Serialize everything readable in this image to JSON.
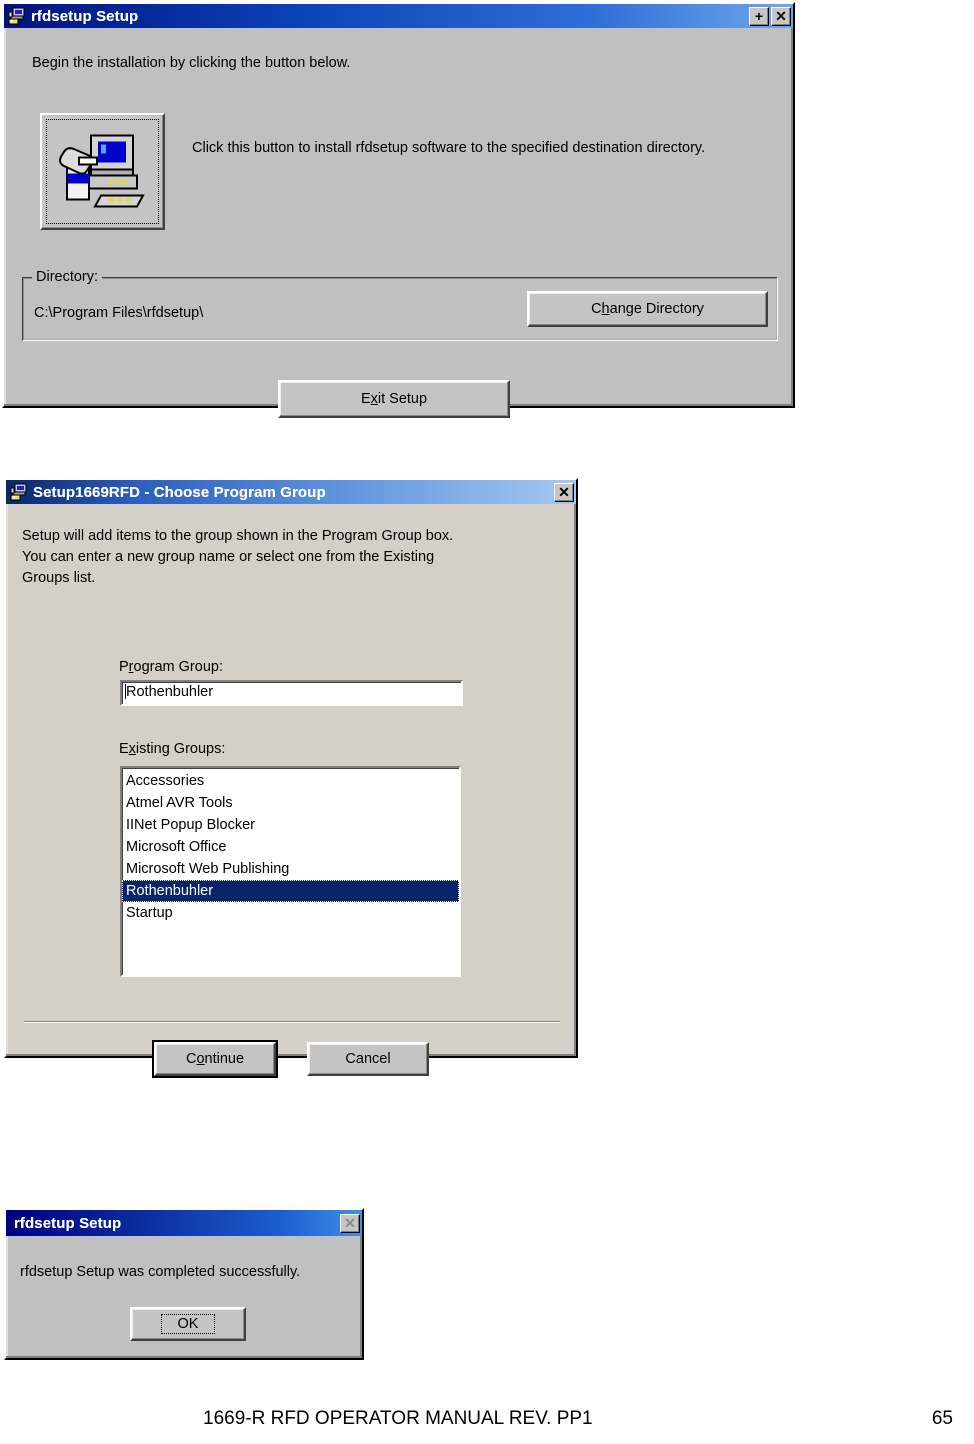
{
  "page": {
    "footer_title": "1669-R RFD OPERATOR MANUAL REV. PP1",
    "footer_page": "65"
  },
  "dialog_install": {
    "title": "rfdsetup Setup",
    "title_icon": "setup-computer-icon",
    "titlebar_buttons": [
      {
        "name": "maximize-button",
        "glyph": "+"
      },
      {
        "name": "close-button",
        "glyph": "✕"
      }
    ],
    "instruction": "Begin the installation by clicking the button below.",
    "install_button": {
      "icon": "computer-install-icon",
      "description": "Click this button to install rfdsetup software to the specified destination directory."
    },
    "directory_group": {
      "label": "Directory:",
      "path": "C:\\Program Files\\rfdsetup\\",
      "change_button": {
        "pre": "C",
        "accel": "h",
        "post": "ange Directory",
        "full": "Change Directory"
      }
    },
    "exit_button": {
      "pre": "E",
      "accel": "x",
      "post": "it Setup",
      "full": "Exit Setup"
    }
  },
  "dialog_group": {
    "title": "Setup1669RFD - Choose Program Group",
    "title_icon": "setup-computer-icon",
    "close_button": "✕",
    "instruction": "Setup will add items to the group shown in the Program Group box.\nYou can enter a new group name or select one from the Existing\nGroups list.",
    "program_group": {
      "label_pre": "P",
      "label_accel": "r",
      "label_post": "ogram Group:",
      "label_full": "Program Group:",
      "value": "Rothenbuhler"
    },
    "existing_groups": {
      "label_pre": "E",
      "label_accel": "x",
      "label_post": "isting Groups:",
      "label_full": "Existing Groups:",
      "items": [
        "Accessories",
        "Atmel AVR Tools",
        "IINet Popup Blocker",
        "Microsoft Office",
        "Microsoft Web Publishing",
        "Rothenbuhler",
        "Startup"
      ],
      "selected_index": 5
    },
    "continue_button": {
      "pre": "C",
      "accel": "o",
      "post": "ntinue",
      "full": "Continue"
    },
    "cancel_button": {
      "full": "Cancel"
    }
  },
  "dialog_complete": {
    "title": "rfdsetup Setup",
    "close_button": "✕",
    "message": "rfdsetup Setup was completed successfully.",
    "ok_button": "OK"
  },
  "colors": {
    "dialog_face": "#c0c0c0",
    "dialog_face_warm": "#d4d0c8",
    "titlebar_blue_dark": "#00137f",
    "titlebar_blue_light": "#6fa7ea",
    "selection_blue": "#0a246a"
  }
}
